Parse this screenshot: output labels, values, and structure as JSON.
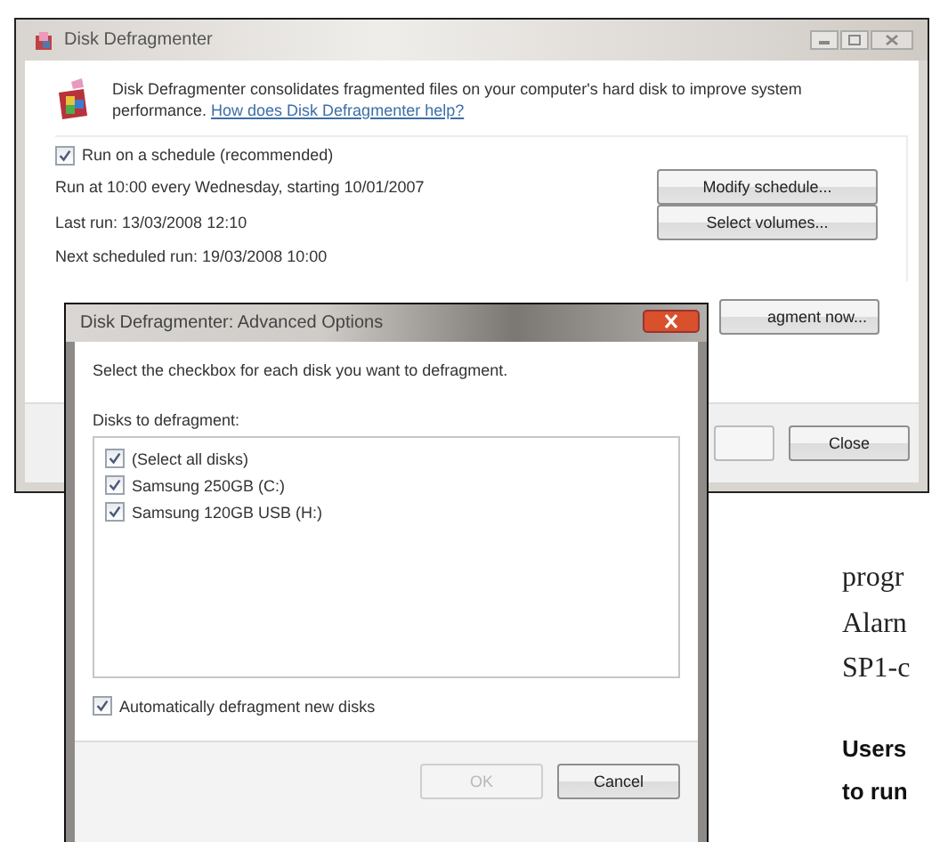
{
  "main_window": {
    "title": "Disk Defragmenter",
    "description": "Disk Defragmenter consolidates fragmented files on your computer's hard disk to improve system performance.",
    "help_link": "How does Disk Defragmenter help?",
    "schedule": {
      "label": "Run on a schedule (recommended)",
      "checked": true
    },
    "schedule_lines": [
      "Run at 10:00 every Wednesday, starting 10/01/2007",
      "Last run: 13/03/2008 12:10",
      "Next scheduled run: 19/03/2008 10:00"
    ],
    "buttons": [
      {
        "label": "Modify schedule..."
      },
      {
        "label": "Select volumes..."
      }
    ],
    "defragment_button": {
      "label": "agment now..."
    },
    "footer_buttons": [
      {
        "label": "Close"
      }
    ]
  },
  "dialog": {
    "title": "Disk Defragmenter: Advanced Options",
    "instruction": "Select the checkbox for each disk you want to defragment.",
    "list_label": "Disks to defragment:",
    "disks": [
      {
        "label": "(Select all disks)",
        "checked": true
      },
      {
        "label": "Samsung 250GB (C:)",
        "checked": true
      },
      {
        "label": "Samsung 120GB USB (H:)",
        "checked": true
      }
    ],
    "auto_defragment": {
      "label": "Automatically defragment new disks",
      "checked": true
    },
    "buttons": [
      {
        "label": "OK",
        "disabled": true
      },
      {
        "label": "Cancel",
        "disabled": false
      }
    ]
  },
  "article": {
    "lines": [
      "progr",
      "Alarn",
      "SP1-c"
    ],
    "heading_lines": [
      "Users",
      "to run"
    ]
  }
}
